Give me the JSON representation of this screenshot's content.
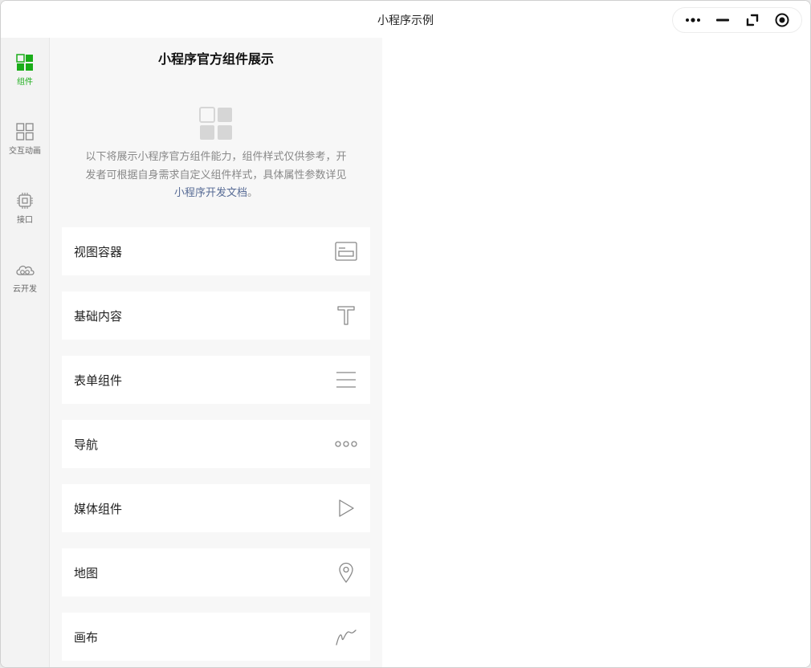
{
  "window": {
    "title": "小程序示例"
  },
  "capsule": {
    "more_icon": "more-dots-icon",
    "minimize_icon": "minimize-icon",
    "restore_icon": "restore-icon",
    "close_icon": "record-icon"
  },
  "tabs": [
    {
      "label": "组件",
      "icon": "components-icon",
      "active": true
    },
    {
      "label": "交互动画",
      "icon": "animation-icon",
      "active": false
    },
    {
      "label": "接口",
      "icon": "chip-icon",
      "active": false
    },
    {
      "label": "云开发",
      "icon": "cloud-icon",
      "active": false
    }
  ],
  "page": {
    "title": "小程序官方组件展示",
    "desc_text": "以下将展示小程序官方组件能力，组件样式仅供参考，开发者可根据自身需求自定义组件样式，具体属性参数详见",
    "desc_link": "小程序开发文档",
    "desc_end": "。",
    "items": [
      {
        "label": "视图容器",
        "icon": "view-container-icon"
      },
      {
        "label": "基础内容",
        "icon": "text-icon"
      },
      {
        "label": "表单组件",
        "icon": "form-lines-icon"
      },
      {
        "label": "导航",
        "icon": "navigation-dots-icon"
      },
      {
        "label": "媒体组件",
        "icon": "play-icon"
      },
      {
        "label": "地图",
        "icon": "map-pin-icon"
      },
      {
        "label": "画布",
        "icon": "canvas-stroke-icon"
      }
    ]
  },
  "colors": {
    "accent": "#1aad19",
    "link": "#576b95",
    "page_bg": "#f7f7f7",
    "icon_gray": "#999999"
  }
}
